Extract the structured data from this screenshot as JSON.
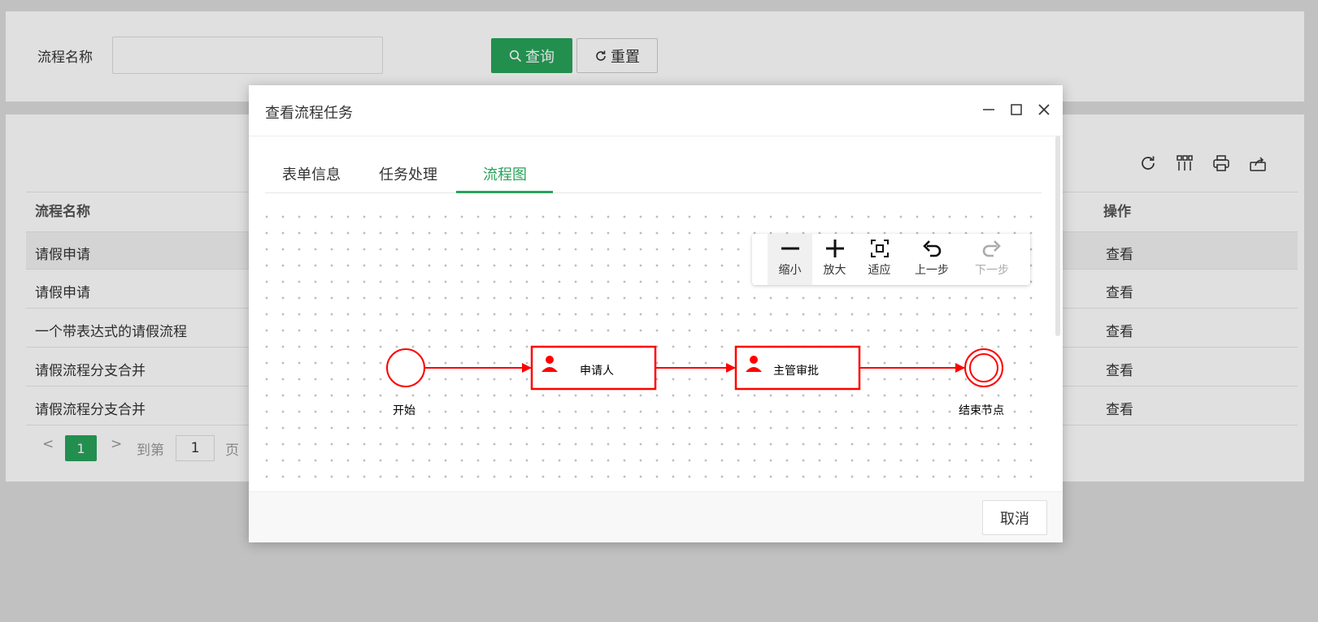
{
  "search": {
    "label": "流程名称",
    "input_value": "",
    "query_button": "查询",
    "reset_button": "重置"
  },
  "toolbar_icons": [
    "refresh-icon",
    "columns-icon",
    "print-icon",
    "export-icon"
  ],
  "table": {
    "headers": {
      "name": "流程名称",
      "action": "操作"
    },
    "rows": [
      {
        "name": "请假申请",
        "action": "查看"
      },
      {
        "name": "请假申请",
        "action": "查看"
      },
      {
        "name": "一个带表达式的请假流程",
        "action": "查看"
      },
      {
        "name": "请假流程分支合并",
        "action": "查看"
      },
      {
        "name": "请假流程分支合并",
        "action": "查看"
      }
    ]
  },
  "pager": {
    "current": "1",
    "goto_label": "到第",
    "goto_value": "1",
    "page_label": "页"
  },
  "modal": {
    "title": "查看流程任务",
    "tabs": [
      {
        "label": "表单信息"
      },
      {
        "label": "任务处理"
      },
      {
        "label": "流程图"
      }
    ],
    "active_tab": "流程图",
    "zoom_toolbar": [
      {
        "label": "缩小",
        "icon": "zoom-out-icon"
      },
      {
        "label": "放大",
        "icon": "zoom-in-icon"
      },
      {
        "label": "适应",
        "icon": "fit-icon"
      },
      {
        "label": "上一步",
        "icon": "undo-icon"
      },
      {
        "label": "下一步",
        "icon": "redo-icon"
      }
    ],
    "diagram": {
      "start_label": "开始",
      "task1_label": "申请人",
      "task2_label": "主管审批",
      "end_label": "结束节点",
      "color": "#ff0000"
    },
    "cancel_button": "取消"
  },
  "colors": {
    "primary": "#27a35a",
    "flow": "#ff0000"
  }
}
